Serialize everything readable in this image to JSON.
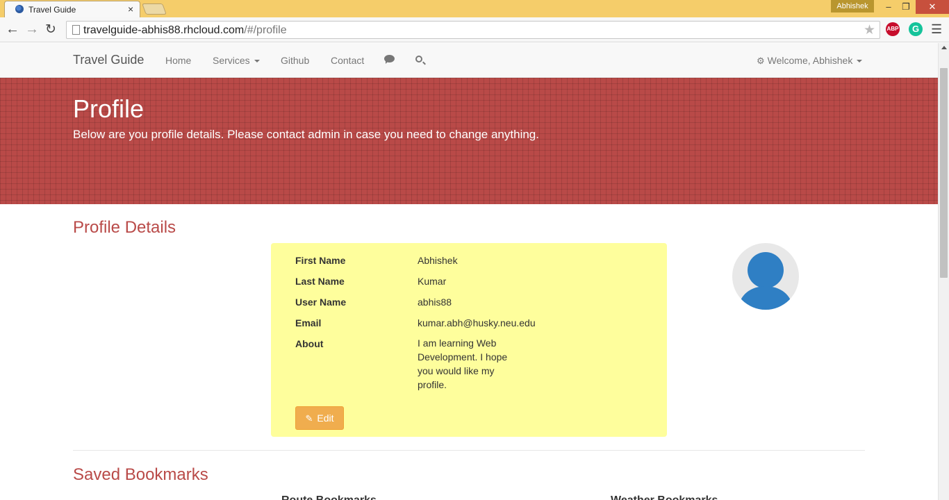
{
  "browser": {
    "tab_title": "Travel Guide",
    "tab_close": "×",
    "user_badge": "Abhishek",
    "url_host": "travelguide-abhis88.rhcloud.com",
    "url_path": "/#/profile",
    "abp_label": "ABP",
    "grammarly_label": "G"
  },
  "navbar": {
    "brand": "Travel Guide",
    "links": [
      "Home",
      "Services",
      "Github",
      "Contact"
    ],
    "welcome": "Welcome, Abhishek"
  },
  "hero": {
    "title": "Profile",
    "subtitle": "Below are you profile details. Please contact admin in case you need to change anything."
  },
  "profile": {
    "section_title": "Profile Details",
    "fields": [
      {
        "label": "First Name",
        "value": "Abhishek"
      },
      {
        "label": "Last Name",
        "value": "Kumar"
      },
      {
        "label": "User Name",
        "value": "abhis88"
      },
      {
        "label": "Email",
        "value": "kumar.abh@husky.neu.edu"
      },
      {
        "label": "About",
        "value": "I am learning Web Development. I hope you would like my profile."
      }
    ],
    "edit_label": "Edit"
  },
  "bookmarks": {
    "section_title": "Saved Bookmarks",
    "route_heading": "Route Bookmarks",
    "weather_heading": "Weather Bookmarks"
  },
  "colors": {
    "accent": "#b94a48",
    "card_bg": "#fefe9c",
    "button": "#f0ad4e",
    "avatar": "#2f7fc4"
  }
}
